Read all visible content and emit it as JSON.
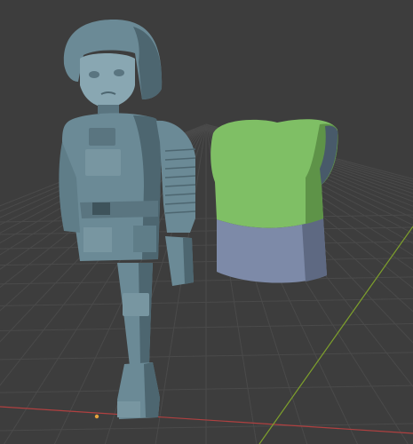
{
  "viewport": {
    "background": "#3d3d3d",
    "grid_color": "#4a4a4a",
    "x_axis_color": "#b04040",
    "y_axis_color": "#7ea02c"
  },
  "objects": {
    "character": {
      "material_color": "#6b8a96",
      "shade_color": "#4d6670",
      "highlight_color": "#89a7b2"
    },
    "shirt_block": {
      "top_color": "#7fbf65",
      "top_shade": "#5e9348",
      "bottom_color": "#7d8aa8",
      "bottom_shade": "#5e6982"
    }
  },
  "origin_marker": {
    "color": "#e6a23c"
  }
}
